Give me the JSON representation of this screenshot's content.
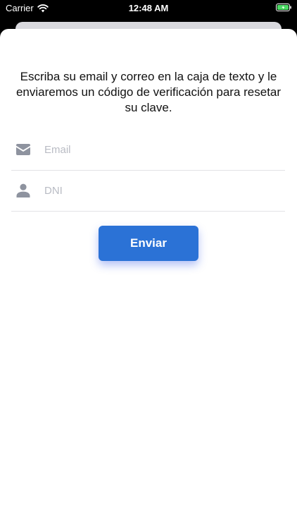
{
  "status_bar": {
    "carrier": "Carrier",
    "time": "12:48 AM",
    "battery_color": "#4cd964"
  },
  "form": {
    "instruction": "Escriba su email y correo en la caja de texto y le enviaremos un código de verificación para resetar su clave.",
    "email": {
      "value": "",
      "placeholder": "Email",
      "icon": "envelope-icon"
    },
    "dni": {
      "value": "",
      "placeholder": "DNI",
      "icon": "person-icon"
    },
    "submit_label": "Enviar"
  },
  "colors": {
    "accent": "#2b72d6",
    "icon": "#8e939f",
    "placeholder": "#b9bcc4"
  }
}
